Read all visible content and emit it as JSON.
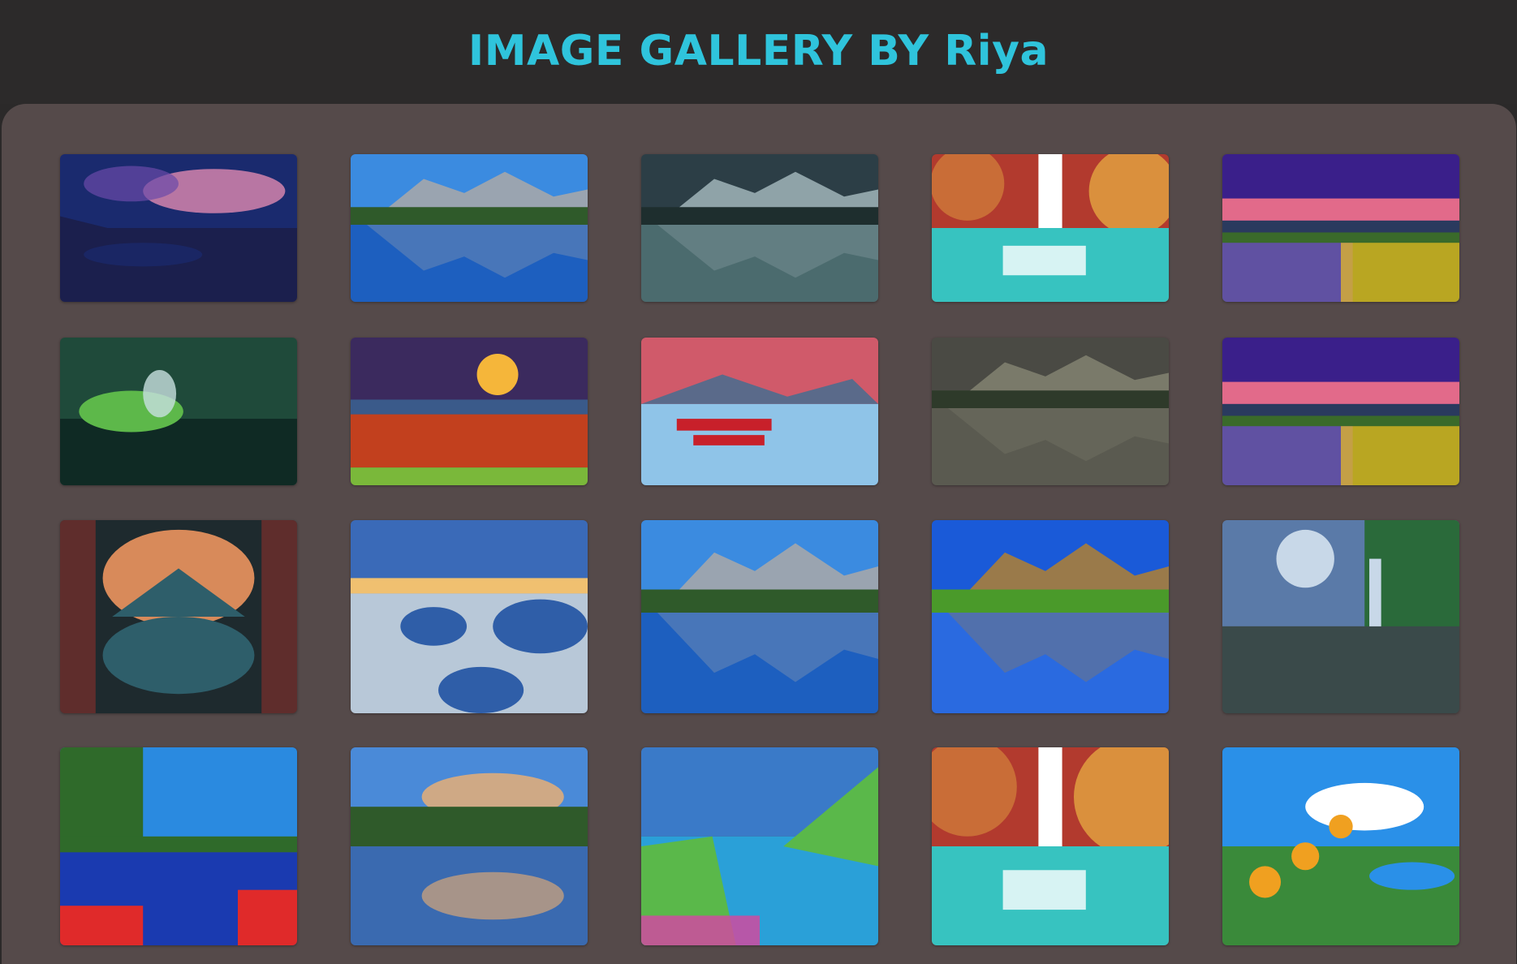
{
  "header": {
    "title": "IMAGE GALLERY BY Riya",
    "title_color": "#2fc4dc"
  },
  "colors": {
    "page_bg": "#2b2929",
    "panel_bg": "#554a4a"
  },
  "gallery": {
    "rows": 4,
    "columns": 5,
    "images": [
      {
        "name": "blue-lake-sunset-image",
        "scene": "night-lake",
        "palette": [
          "#1a2a6e",
          "#6b4aa8",
          "#e08ab0",
          "#1b1f4d"
        ]
      },
      {
        "name": "mountain-pebble-lake-image",
        "scene": "mountain-lake",
        "palette": [
          "#3b8be0",
          "#9aa4b0",
          "#2f5a2a",
          "#1d5fbf"
        ]
      },
      {
        "name": "dark-peak-reflection-image",
        "scene": "mountain-lake",
        "palette": [
          "#2c3e46",
          "#8fa3a8",
          "#1e2e2e",
          "#4b6b6e"
        ]
      },
      {
        "name": "autumn-waterfall-image",
        "scene": "waterfall",
        "palette": [
          "#b23a2e",
          "#e0a040",
          "#37c3c0",
          "#ffffff"
        ]
      },
      {
        "name": "purple-sky-flower-field-image",
        "scene": "flower-field",
        "palette": [
          "#3a1f8a",
          "#e26a8a",
          "#6a4bc0",
          "#f0c020"
        ]
      },
      {
        "name": "butterfly-leaves-image",
        "scene": "butterfly",
        "palette": [
          "#1f4a3a",
          "#5db84a",
          "#c8e0e0",
          "#0f2a24"
        ]
      },
      {
        "name": "autumn-valley-sunset-image",
        "scene": "autumn-valley",
        "palette": [
          "#3b2a5e",
          "#f5b63a",
          "#c2401e",
          "#7ab83a"
        ]
      },
      {
        "name": "red-boats-lake-image",
        "scene": "boats-lake",
        "palette": [
          "#d05a6a",
          "#5a6a8a",
          "#c8202a",
          "#8fc4e8"
        ]
      },
      {
        "name": "stormy-island-lake-image",
        "scene": "mountain-lake",
        "palette": [
          "#4a4a44",
          "#7a7a6a",
          "#2e3a2a",
          "#5a5a50"
        ]
      },
      {
        "name": "purple-sky-flower-field-image-2",
        "scene": "flower-field",
        "palette": [
          "#3a1f8a",
          "#e26a8a",
          "#6a4bc0",
          "#f0c020"
        ]
      },
      {
        "name": "red-forest-reflection-image",
        "scene": "cave-reflection",
        "palette": [
          "#1e2a2e",
          "#d88a5a",
          "#a0302a",
          "#2e5e6a"
        ]
      },
      {
        "name": "blue-rocks-river-image",
        "scene": "rocks-river",
        "palette": [
          "#3a6ab8",
          "#f0c070",
          "#2f5ea8",
          "#b8c8d8"
        ]
      },
      {
        "name": "mountain-pebble-lake-image-2",
        "scene": "mountain-lake",
        "palette": [
          "#3b8be0",
          "#9aa4b0",
          "#2f5a2a",
          "#1d5fbf"
        ]
      },
      {
        "name": "green-forest-mountain-lake-image",
        "scene": "mountain-lake",
        "palette": [
          "#1a5ad8",
          "#9a7a4a",
          "#4a9a2a",
          "#2a6ae0"
        ]
      },
      {
        "name": "waterfall-canyon-image",
        "scene": "canyon-waterfall",
        "palette": [
          "#5a7aa8",
          "#c8d8e8",
          "#3a4a4a",
          "#2a6a3a"
        ]
      },
      {
        "name": "tree-lake-flowers-image",
        "scene": "lake-flowers",
        "palette": [
          "#2a8ae0",
          "#2f6a2a",
          "#1a3ab0",
          "#e02a2a"
        ]
      },
      {
        "name": "sky-reflection-lake-image",
        "scene": "sky-reflection",
        "palette": [
          "#4a8ad8",
          "#f0b070",
          "#2f5a2a",
          "#3a6ab0"
        ]
      },
      {
        "name": "cliff-sea-flowers-image",
        "scene": "cliff-sea",
        "palette": [
          "#3a7ac8",
          "#2aa0d8",
          "#5ab84a",
          "#d04aa0"
        ]
      },
      {
        "name": "autumn-waterfall-image-2",
        "scene": "waterfall",
        "palette": [
          "#b23a2e",
          "#e0a040",
          "#37c3c0",
          "#ffffff"
        ]
      },
      {
        "name": "yellow-lilies-lake-image",
        "scene": "lilies-lake",
        "palette": [
          "#2a90e8",
          "#ffffff",
          "#3a8a3a",
          "#f0a020"
        ]
      }
    ]
  }
}
